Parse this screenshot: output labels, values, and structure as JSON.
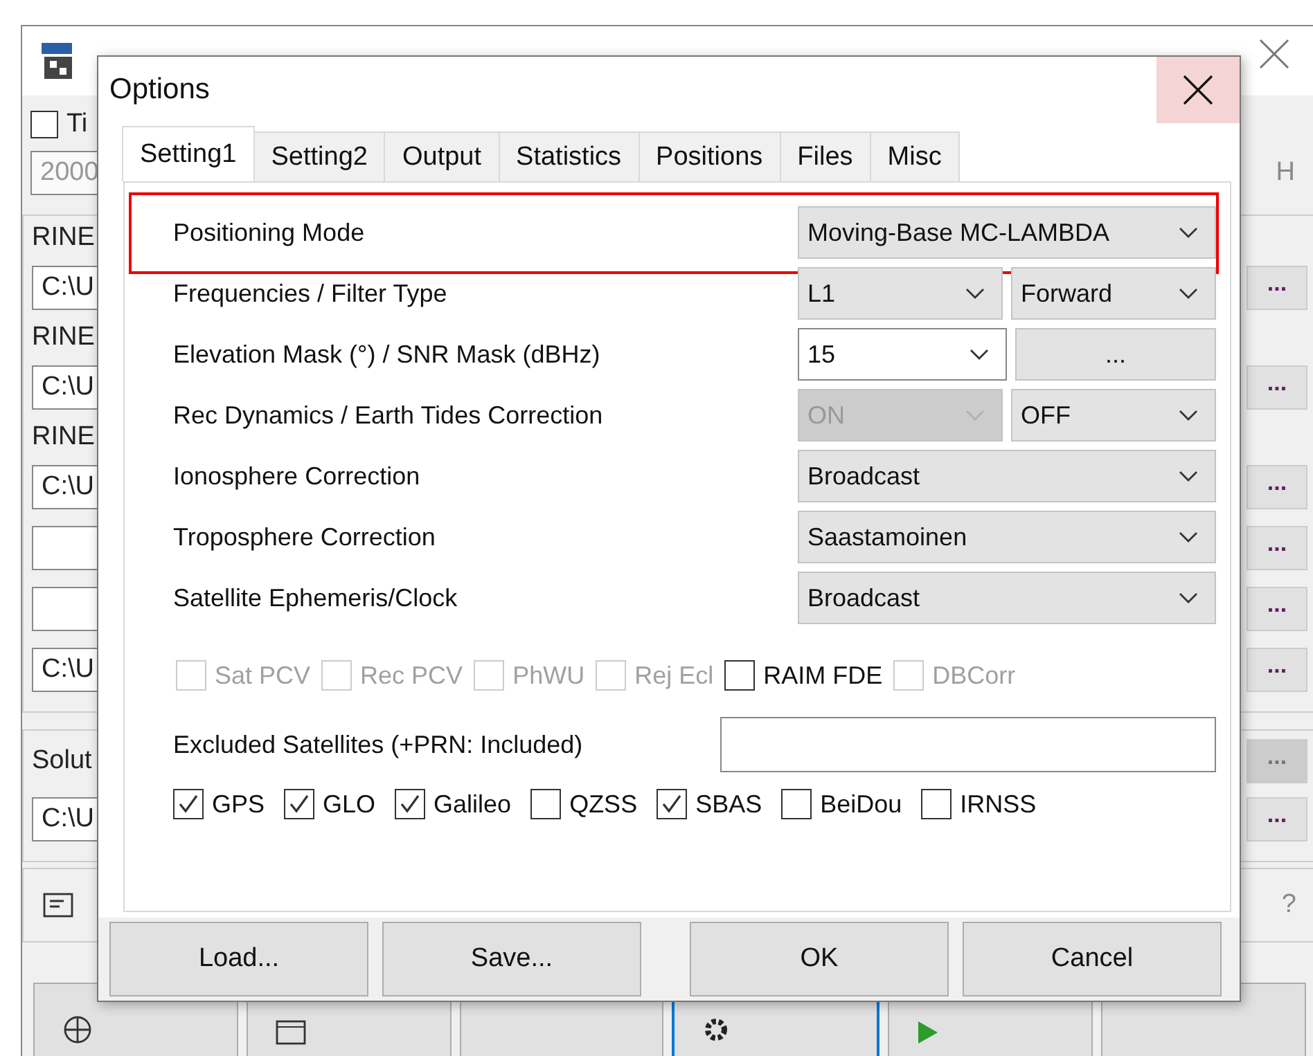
{
  "background_window": {
    "time_checkbox": {
      "label": "Ti",
      "checked": false
    },
    "time_field": "2000",
    "time_unit": "H",
    "input_files": [
      {
        "label": "RINE",
        "value": "C:\\U",
        "browse": {
          "text": "...",
          "disabled": false
        }
      },
      {
        "label": "RINE",
        "value": "C:\\U",
        "browse": {
          "text": "...",
          "disabled": false
        }
      },
      {
        "label": "RINE",
        "value": "C:\\U",
        "browse": {
          "text": "...",
          "disabled": false
        }
      },
      {
        "browse": {
          "text": "...",
          "disabled": false
        }
      },
      {
        "browse": {
          "text": "...",
          "disabled": false
        }
      },
      {
        "value": "C:\\U",
        "browse": {
          "text": "...",
          "disabled": false
        }
      }
    ],
    "solution": {
      "label": "Solut",
      "label_browse": {
        "text": "...",
        "disabled": true
      },
      "value": "C:\\U",
      "browse": {
        "text": "...",
        "disabled": false
      }
    },
    "help": "?",
    "toolbar": [
      {
        "kind": "plot",
        "focused": false
      },
      {
        "kind": "view",
        "focused": false
      },
      {
        "kind": "kml",
        "focused": false
      },
      {
        "kind": "options",
        "focused": true
      },
      {
        "kind": "execute",
        "focused": false
      },
      {
        "kind": "exit",
        "focused": false
      }
    ]
  },
  "dialog": {
    "title": "Options",
    "tabs": [
      {
        "label": "Setting1",
        "selected": true
      },
      {
        "label": "Setting2",
        "selected": false
      },
      {
        "label": "Output",
        "selected": false
      },
      {
        "label": "Statistics",
        "selected": false
      },
      {
        "label": "Positions",
        "selected": false
      },
      {
        "label": "Files",
        "selected": false
      },
      {
        "label": "Misc",
        "selected": false
      }
    ],
    "settings": [
      {
        "label": "Positioning Mode",
        "highlighted": true,
        "controls": [
          {
            "kind": "combo",
            "value": "Moving-Base MC-LAMBDA",
            "disabled": false
          }
        ]
      },
      {
        "label": "Frequencies / Filter Type",
        "highlighted": false,
        "controls": [
          {
            "kind": "combo",
            "value": "L1",
            "disabled": false
          },
          {
            "kind": "combo",
            "value": "Forward",
            "disabled": false
          }
        ]
      },
      {
        "label": "Elevation Mask (°) / SNR Mask (dBHz)",
        "highlighted": false,
        "controls": [
          {
            "kind": "edit-combo",
            "value": "15",
            "disabled": false
          },
          {
            "kind": "button",
            "value": "...",
            "disabled": false
          }
        ]
      },
      {
        "label": "Rec Dynamics / Earth Tides Correction",
        "highlighted": false,
        "controls": [
          {
            "kind": "combo",
            "value": "ON",
            "disabled": true
          },
          {
            "kind": "combo",
            "value": "OFF",
            "disabled": false
          }
        ]
      },
      {
        "label": "Ionosphere Correction",
        "highlighted": false,
        "controls": [
          {
            "kind": "combo",
            "value": "Broadcast",
            "disabled": false
          }
        ]
      },
      {
        "label": "Troposphere Correction",
        "highlighted": false,
        "controls": [
          {
            "kind": "combo",
            "value": "Saastamoinen",
            "disabled": false
          }
        ]
      },
      {
        "label": "Satellite Ephemeris/Clock",
        "highlighted": false,
        "controls": [
          {
            "kind": "combo",
            "value": "Broadcast",
            "disabled": false
          }
        ]
      }
    ],
    "options": [
      {
        "label": "Sat PCV",
        "checked": false,
        "disabled": true
      },
      {
        "label": "Rec PCV",
        "checked": false,
        "disabled": true
      },
      {
        "label": "PhWU",
        "checked": false,
        "disabled": true
      },
      {
        "label": "Rej Ecl",
        "checked": false,
        "disabled": true
      },
      {
        "label": "RAIM FDE",
        "checked": false,
        "disabled": false
      },
      {
        "label": "DBCorr",
        "checked": false,
        "disabled": true
      }
    ],
    "excluded_satellites": {
      "label": "Excluded Satellites (+PRN: Included)"
    },
    "systems": [
      {
        "label": "GPS",
        "checked": true
      },
      {
        "label": "GLO",
        "checked": true
      },
      {
        "label": "Galileo",
        "checked": true
      },
      {
        "label": "QZSS",
        "checked": false
      },
      {
        "label": "SBAS",
        "checked": true
      },
      {
        "label": "BeiDou",
        "checked": false
      },
      {
        "label": "IRNSS",
        "checked": false
      }
    ],
    "buttons": [
      "Load...",
      "Save...",
      "OK",
      "Cancel"
    ]
  }
}
